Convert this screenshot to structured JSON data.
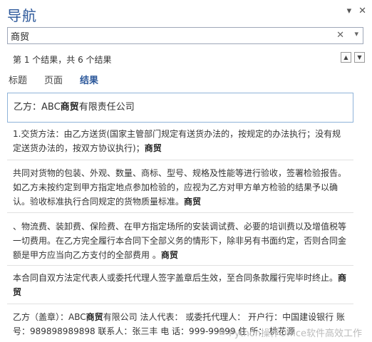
{
  "header": {
    "title": "导航"
  },
  "search": {
    "query": "商贸"
  },
  "status": {
    "result_count": "第 1 个结果，共 6 个结果"
  },
  "tabs": [
    {
      "label": "标题"
    },
    {
      "label": "页面"
    },
    {
      "label": "结果"
    }
  ],
  "results": [
    {
      "text": "乙方：ABC",
      "keyword": "商贸",
      "after": "有限责任公司"
    },
    {
      "text": "1.交货方法：由乙方送货(国家主管部门规定有送货办法的，按规定的办法执行；没有规定送货办法的，按双方协议执行)；",
      "keyword": "商贸",
      "after": ""
    },
    {
      "text": "共同对货物的包装、外观、数量、商标、型号、规格及性能等进行验收，签署检验报告。如乙方未按约定到甲方指定地点参加检验的，应视为乙方对甲方单方检验的结果予以确认。验收标准执行合同规定的货物质量标准。",
      "keyword": "商贸",
      "after": ""
    },
    {
      "text": "、物流费、装卸费、保险费、在甲方指定场所的安装调试费、必要的培训费以及增值税等一切费用。在乙方完全履行本合同下全部义务的情形下，除非另有书面约定，否则合同金额是甲方应当向乙方支付的全部费用 。",
      "keyword": "商贸",
      "after": ""
    },
    {
      "text": "本合同自双方法定代表人或委托代理人签字盖章后生效，至合同条款履行完毕时终止。",
      "keyword": "商贸",
      "after": ""
    },
    {
      "text": "乙方（盖章）：ABC",
      "keyword": "商贸",
      "after": "有限公司  法人代表： 或委托代理人：  开户行：中国建设银行  账  号：989898989898 联系人：张三丰 电  话：999-99999 住  所： 桃花源"
    }
  ],
  "watermark": {
    "text": "Python操作Office软件高效工作"
  }
}
